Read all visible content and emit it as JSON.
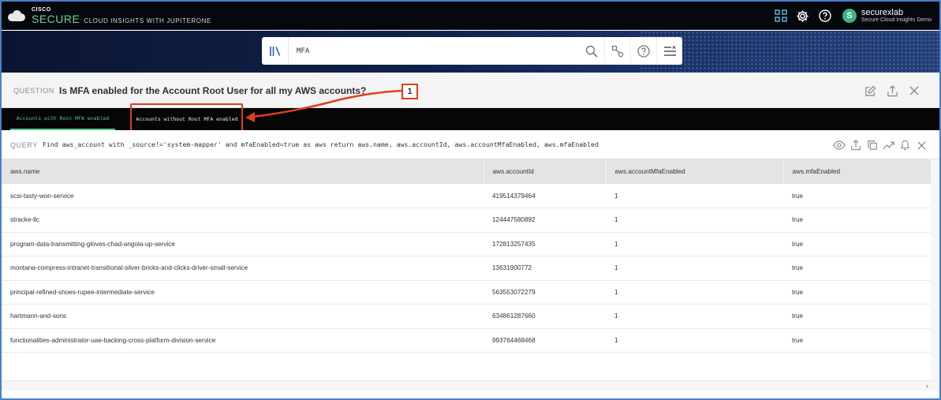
{
  "header": {
    "brand_cisco": "CISCO",
    "brand_secure": "SECURE",
    "brand_sub": "CLOUD INSIGHTS WITH JUPITERONE",
    "avatar_initial": "S",
    "user_name": "securexlab",
    "user_org": "Secure Cloud Insights Demo"
  },
  "search": {
    "value": "MFA"
  },
  "question": {
    "label": "QUESTION",
    "text": "Is MFA enabled for the Account Root User for all my AWS accounts?"
  },
  "tabs": [
    {
      "label": "Accounts with Root MFA enabled",
      "active": true
    },
    {
      "label": "Accounts without Root MFA enabled",
      "active": false
    }
  ],
  "annotation": {
    "number": "1",
    "color": "#e23d1d"
  },
  "query": {
    "label": "QUERY",
    "text": "Find aws_account with _source!='system-mapper' and mfaEnabled=true as aws return aws.name, aws.accountId, aws.accountMfaEnabled, aws.mfaEnabled"
  },
  "table": {
    "columns": [
      "aws.name",
      "aws.accountId",
      "aws.accountMfaEnabled",
      "aws.mfaEnabled"
    ],
    "rows": [
      [
        "scsi-tasty-won-service",
        "419514379464",
        "1",
        "true"
      ],
      [
        "stracke-llc",
        "124447580892",
        "1",
        "true"
      ],
      [
        "program-data-transmitting-gloves-chad-angola-up-service",
        "172813257435",
        "1",
        "true"
      ],
      [
        "montana-compress-intranet-transitional-silver-bricks-and-clicks-driver-small-service",
        "13631900772",
        "1",
        "true"
      ],
      [
        "principal-refined-shoes-rupee-intermediate-service",
        "563553072279",
        "1",
        "true"
      ],
      [
        "hartmann-and-sons",
        "634861287660",
        "1",
        "true"
      ],
      [
        "functionalities-administrator-uae-backing-cross-platform-division-service",
        "993764468468",
        "1",
        "true"
      ]
    ]
  },
  "colors": {
    "accent_green": "#4cc98c",
    "brand_green": "#6fd19a",
    "highlight_red": "#e23d1d",
    "frame_blue": "#4a7fc8"
  },
  "icons": {
    "top": [
      "apps-grid-icon",
      "gear-icon",
      "help-icon"
    ],
    "search": [
      "library-icon",
      "search-icon",
      "graph-toggle-icon",
      "help-icon",
      "filter-menu-icon"
    ],
    "question": [
      "edit-icon",
      "share-icon",
      "close-icon"
    ],
    "query": [
      "eye-icon",
      "share-icon",
      "copy-icon",
      "trend-icon",
      "bell-icon",
      "close-icon"
    ]
  }
}
